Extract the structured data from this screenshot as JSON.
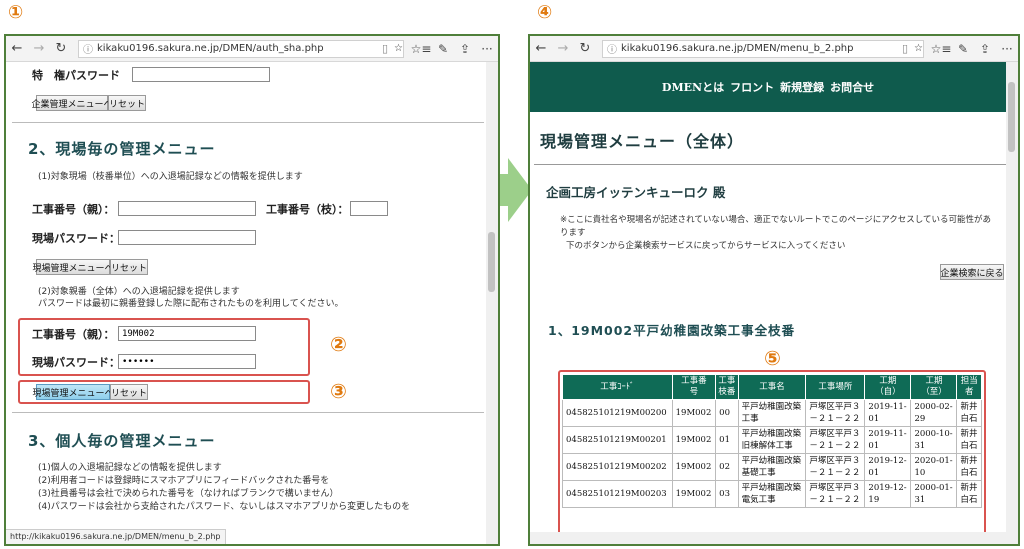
{
  "steps": {
    "s1": "①",
    "s2": "②",
    "s3": "③",
    "s4": "④",
    "s5": "⑤"
  },
  "browser": {
    "left_url": "kikaku0196.sakura.ne.jp/DMEN/auth_sha.php",
    "right_url": "kikaku0196.sakura.ne.jp/DMEN/menu_b_2.php",
    "status_url": "http://kikaku0196.sakura.ne.jp/DMEN/menu_b_2.php",
    "back_icon": "back-arrow-icon",
    "forward_icon": "forward-arrow-icon",
    "refresh_icon": "refresh-icon"
  },
  "left": {
    "privilege_label": "特　権パスワード　：",
    "privilege_button1": "企業管理メニューへ",
    "reset": "リセット",
    "section2_title": "2、現場毎の管理メニュー",
    "section2_note": "(1)対象現場（枝番単位）への入退場記録などの情報を提供します",
    "parent_no_label": "工事番号（親）：",
    "branch_no_label": "工事番号（枝）：",
    "site_pw_label": "現場パスワード：",
    "site_menu_button": "現場管理メニューへ",
    "section2_note2_line1": "(2)対象親番（全体）への入退場記録を提供します",
    "section2_note2_line2": "パスワードは最初に親番登録した際に配布されたものを利用してください。",
    "parent_no_label2": "工事番号（親）：",
    "parent_no_value": "19M002",
    "site_pw_label2": "現場パスワード：",
    "site_pw_value": "••••••",
    "section3_title": "3、個人毎の管理メニュー",
    "s3_lines": [
      "(1)個人の入退場記録などの情報を提供します",
      "(2)利用者コードは登録時にスマホアプリにフィードバックされた番号を",
      "(3)社員番号は会社で決められた番号を（なければブランクで構いません）",
      "(4)パスワードは会社から支給されたパスワード、ないしはスマホアプリから変更したものを"
    ]
  },
  "right": {
    "nav": [
      "DMENとは",
      "フロント",
      "新規登録",
      "お問合せ"
    ],
    "page_title": "現場管理メニュー（全体）",
    "company": "企画工房イッテンキューロク 殿",
    "warn1": "※ここに貴社名や現場名が記述されていない場合、適正でないルートでこのページにアクセスしている可能性があ",
    "warn2": "ります",
    "warn3": "下のボタンから企業検索サービスに戻ってからサービスに入ってください",
    "search_back_button": "企業検索に戻る",
    "project_title": "1、19M002平戸幼稚園改築工事全枝番",
    "table": {
      "headers": [
        "工事ｺｰﾄﾞ",
        "工事番\n号",
        "工事\n枝番",
        "工事名",
        "工事場所",
        "工期\n（自）",
        "工期\n（至）",
        "担当\n者"
      ],
      "rows": [
        [
          "045825101219M00200",
          "19M002",
          "00",
          "平戸幼稚園改築\n工事",
          "戸塚区平戸３\n－２１－２２",
          "2019-11-\n01",
          "2000-02-\n29",
          "新井\n白石"
        ],
        [
          "045825101219M00201",
          "19M002",
          "01",
          "平戸幼稚園改築\n旧棟解体工事",
          "戸塚区平戸３\n－２１－２２",
          "2019-11-\n01",
          "2000-10-\n31",
          "新井\n白石"
        ],
        [
          "045825101219M00202",
          "19M002",
          "02",
          "平戸幼稚園改築\n基礎工事",
          "戸塚区平戸３\n－２１－２２",
          "2019-12-\n01",
          "2020-01-\n10",
          "新井\n白石"
        ],
        [
          "045825101219M00203",
          "19M002",
          "03",
          "平戸幼稚園改築\n電気工事",
          "戸塚区平戸３\n－２１－２２",
          "2019-12-\n19",
          "2000-01-\n31",
          "新井\n白石"
        ]
      ]
    }
  },
  "colors": {
    "frame": "#4f7f3a",
    "banner": "#0f5b4d",
    "table_header": "#0f6b56",
    "callout": "#e07a10",
    "highlight_box": "#d9534f",
    "arrow": "#9ccf8a"
  }
}
